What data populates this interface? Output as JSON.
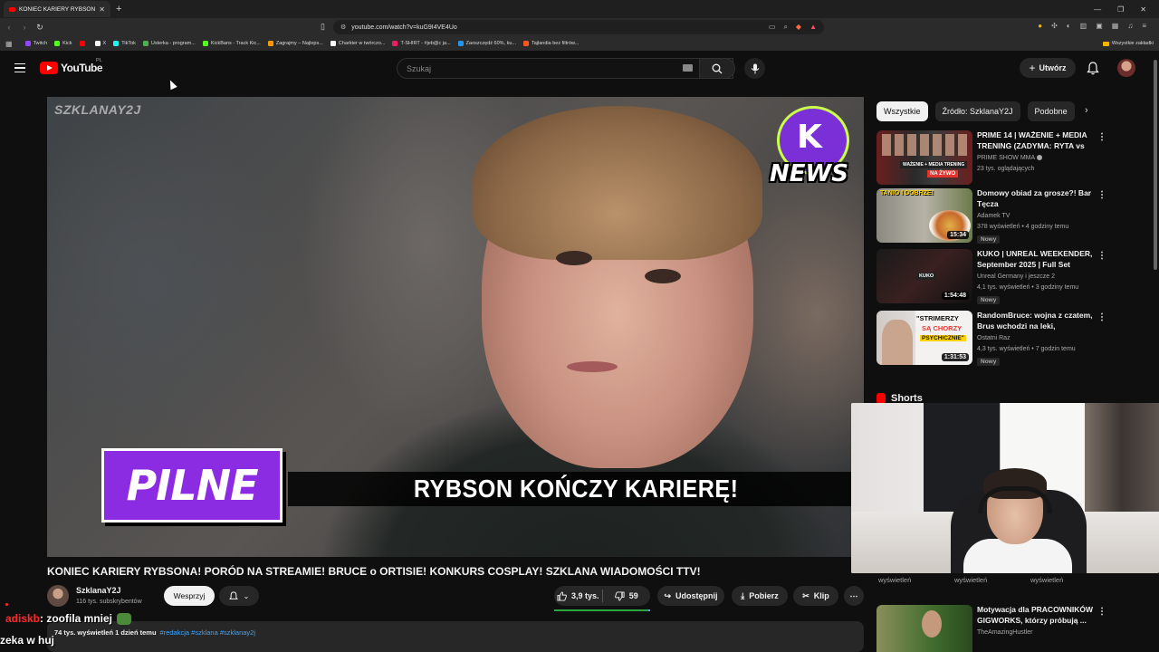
{
  "browser": {
    "tab_title": "KONIEC KARIERY RYBSONA!",
    "url": "youtube.com/watch?v=kuG9I4VE4Uo",
    "bookmarks": [
      {
        "label": "Twitch",
        "color": "#9146ff"
      },
      {
        "label": "Kick",
        "color": "#53fc18"
      },
      {
        "label": "",
        "color": "#ff0000"
      },
      {
        "label": "X",
        "color": "#ffffff"
      },
      {
        "label": "TikTok",
        "color": "#25f4ee"
      },
      {
        "label": "Usterka - program...",
        "color": "#4caf50"
      },
      {
        "label": "KickBans - Track Kic...",
        "color": "#53fc18"
      },
      {
        "label": "Zagrajmy – Najleps...",
        "color": "#ff9800"
      },
      {
        "label": "Charkter w twórczo...",
        "color": "#ffffff"
      },
      {
        "label": "T-SHIRT - #jeb@c ja...",
        "color": "#e91e63"
      },
      {
        "label": "Zaoszczędź 60%, ku...",
        "color": "#2196f3"
      },
      {
        "label": "Tajlandia bez filtrów...",
        "color": "#ff5722"
      }
    ],
    "all_bookmarks_label": "Wszystkie zakładki"
  },
  "header": {
    "logo_text": "YouTube",
    "country_code": "PL",
    "search_placeholder": "Szukaj",
    "create_label": "Utwórz"
  },
  "player": {
    "watermark": "SZKLANAY2J",
    "news_badge_letter": "K",
    "news_badge_text": "NEWS",
    "pilne_label": "PILNE",
    "banner_text": "RYBSON KOŃCZY KARIERĘ!"
  },
  "video": {
    "title": "KONIEC KARIERY RYBSONA! PORÓD NA STREAMIE! BRUCE o ORTISIE! KONKURS COSPLAY! SZKLANA WIADOMOŚCI TTV!",
    "channel_name": "SzklanaY2J",
    "channel_subs": "116 tys. subskrybentów",
    "support_label": "Wesprzyj",
    "likes": "3,9 tys.",
    "dislikes": "59",
    "like_ratio": 0.985,
    "share_label": "Udostępnij",
    "download_label": "Pobierz",
    "clip_label": "Klip",
    "description_meta": "74 tys. wyświetleń  1 dzień temu",
    "description_tags": "#redakcja #szklana #szklanay2j"
  },
  "chat": {
    "user": "adiskb",
    "message": ": zoofila mniej",
    "line2": "zeka w huj"
  },
  "sidebar": {
    "chips": [
      "Wszystkie",
      "Źródło: SzklanaY2J",
      "Podobne"
    ],
    "recommendations": [
      {
        "title": "PRIME 14 | WAŻENIE + MEDIA TRENING (ZADYMA: RYTA vs ...",
        "channel": "PRIME SHOW MMA",
        "meta": "23 tys. oglądających",
        "duration": "",
        "new": "",
        "thumb_live": "NA ŻYWO",
        "thumb_text": "WAŻENIE + MEDIA TRENING",
        "verified": true
      },
      {
        "title": "Domowy obiad za grosze?! Bar Tęcza",
        "channel": "Adamek TV",
        "meta": "378 wyświetleń • 4 godziny temu",
        "duration": "15:34",
        "new": "Nowy",
        "thumb_text": "TANIO I DOBRZE!",
        "verified": false
      },
      {
        "title": "KUKO | UNREAL WEEKENDER, September 2025 | Full Set",
        "channel": "Unreal Germany i jeszcze 2",
        "meta": "4,1 tys. wyświetleń • 3 godziny temu",
        "duration": "1:54:48",
        "new": "Nowy",
        "thumb_text": "KUKO",
        "verified": false
      },
      {
        "title": "RandomBruce: wojna z czatem, Brus wchodzi na leki, mądrość...",
        "channel": "Ostatni Raz",
        "meta": "4,3 tys. wyświetleń • 7 godzin temu",
        "duration": "1:31:53",
        "new": "Nowy",
        "thumb_text_1": "\"STRIMERZY",
        "thumb_text_2": "SĄ CHORZY",
        "thumb_text_3": "PSYCHICZNIE\"",
        "verified": false
      }
    ],
    "shorts_label": "Shorts",
    "shorts_views": [
      "wyświetleń",
      "wyświetleń",
      "wyświetleń"
    ],
    "bottom_rec": {
      "title": "Motywacja dla PRACOWNIKÓW GIGWORKS, którzy próbują ...",
      "channel": "TheAmazingHustler"
    }
  },
  "colors": {
    "yt_red": "#ff0000",
    "accent_purple": "#8b2be2",
    "news_green": "#c9ff4a",
    "like_bar_green": "#2ba640",
    "link_blue": "#3ea6ff"
  }
}
